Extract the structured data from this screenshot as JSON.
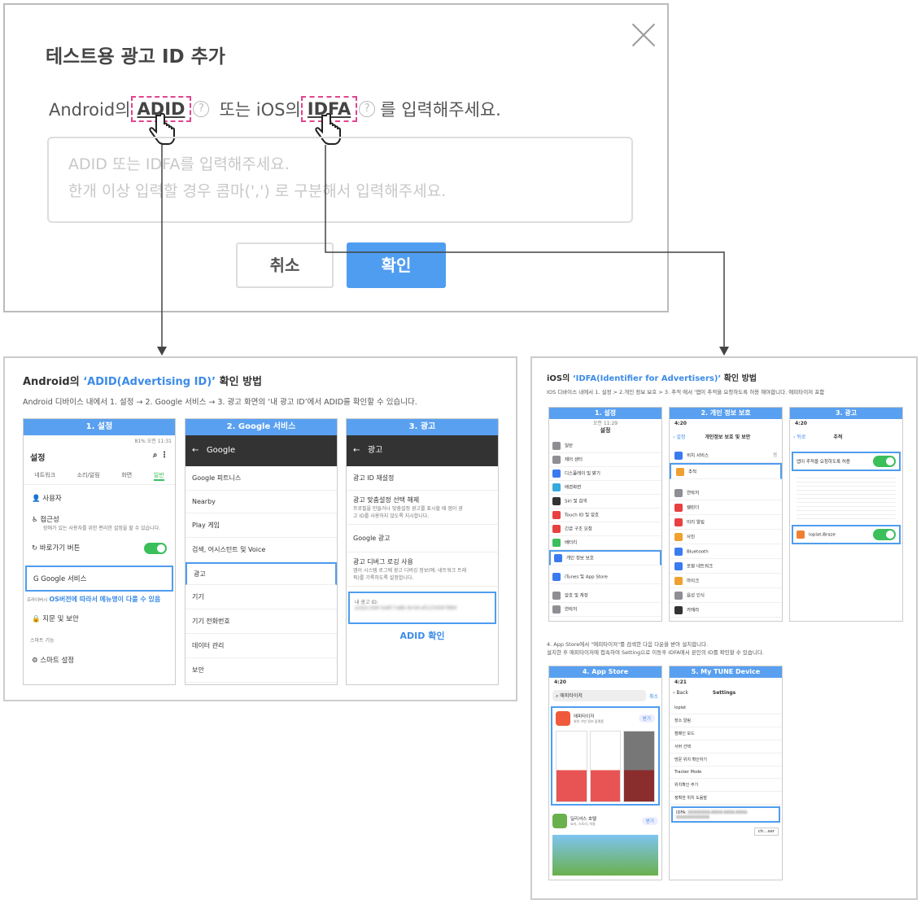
{
  "dialog": {
    "title": "테스트용 광고 ID 추가",
    "prefix": "Android의",
    "adid": "ADID",
    "middle": "또는 iOS의",
    "idfa": "IDFA",
    "suffix": "를 입력해주세요.",
    "qmark": "?",
    "placeholder_line1": "ADID 또는 IDFA를 입력해주세요.",
    "placeholder_line2": "한개 이상 입력할 경우 콤마(',') 로 구분해서 입력해주세요.",
    "cancel": "취소",
    "confirm": "확인"
  },
  "android": {
    "title_prefix": "Android의",
    "title_highlight": "‘ADID(Advertising ID)’",
    "title_suffix": "확인 방법",
    "desc": "Android 디바이스 내에서 1. 설정 → 2. Google 서비스 → 3. 광고 화면의 ‘내 광고 ID’에서 ADID를 확인할 수 있습니다.",
    "s1": {
      "header": "1. 설정",
      "status": "81% 오전 11:31",
      "title": "설정",
      "tabs": [
        "네트워크",
        "소리/알림",
        "화면",
        "일반"
      ],
      "items": [
        {
          "label": "사용자"
        },
        {
          "label": "접근성",
          "sub": "장애가 있는 사용자를 위한 편리한 설정을 할 수 있습니다."
        },
        {
          "label": "바로가기 버튼"
        },
        {
          "label": "Google 서비스"
        }
      ],
      "note": "OS버전에 따라서 메뉴명이 다를 수 있음",
      "section1": "프라이버시",
      "item5": "지문 및 보안",
      "section2": "스마트 기능",
      "item6": "스마트 설정"
    },
    "s2": {
      "header": "2. Google 서비스",
      "bar": "Google",
      "items": [
        "Google 피트니스",
        "Nearby",
        "Play 게임",
        "검색, 어시스턴트 및 Voice",
        "광고",
        "기기",
        "기기 전화번호",
        "데이터 관리",
        "보안"
      ]
    },
    "s3": {
      "header": "3. 광고",
      "bar": "광고",
      "items": [
        {
          "label": "광고 ID 재설정"
        },
        {
          "label": "광고 맞춤설정 선택 해제",
          "sub": "프로필을 만들거나 맞춤설정 광고를 표시할 때 앱이 광고 ID를 사용하지 않도록 지시합니다."
        },
        {
          "label": "Google 광고"
        },
        {
          "label": "광고 디버그 로깅 사용",
          "sub": "앱이 시스템 로그에 광고 디버깅 정보(예: 네트워크 트래픽)를 기록하도록 설정합니다."
        }
      ],
      "adid_label": "내 광고 ID:",
      "adid_value": "a1b2c3d4-5e6f-7a8b-9c0d-ef1234567890",
      "adid_check": "ADID 확인"
    }
  },
  "ios": {
    "title_prefix": "iOS의",
    "title_highlight": "‘IDFA(Identifier for Advertisers)’",
    "title_suffix": "확인 방법",
    "desc": "IOS 디바이스 내에서 1. 설정 > 2.개인 정보 보호 > 3. 추적 에서 ‘앱이 추적을 요청하도록 허용 해야합니다. 애피타이저 포함",
    "s1": {
      "header": "1. 설정",
      "status": "오전 11:29",
      "title": "설정",
      "items": [
        "일반",
        "제어 센터",
        "디스플레이 및 밝기",
        "배경화면",
        "Siri 및 검색",
        "Touch ID 및 암호",
        "긴급 구조 요청",
        "배터리",
        "개인 정보 보호",
        "iTunes 및 App Store",
        "암호 및 계정",
        "연락처"
      ]
    },
    "s2": {
      "header": "2. 개인 정보 보호",
      "time": "4:20",
      "back": "설정",
      "title": "개인정보 보호 및 보안",
      "items": [
        "위치 서비스",
        "추적",
        "연락처",
        "캘린더",
        "미리 알림",
        "사진",
        "Bluetooth",
        "로컬 네트워크",
        "마이크",
        "음성 인식",
        "카메라"
      ],
      "badge": "켬"
    },
    "s3": {
      "header": "3. 광고",
      "time": "4:20",
      "back": "뒤로",
      "title": "추적",
      "allow": "앱이 추적을 요청하도록 허용",
      "app": "loplat-Braze"
    },
    "step4": "4. App Store에서 \"애피타이저\"를 검색한 다음 다운을 받아 설치합니다.",
    "step4b": "설치한 후 애피타이저에 접속하여 Setting으로 이동후 IDFA에서 본인의 ID를 확인할 수 있습니다.",
    "s4": {
      "header": "4. App Store",
      "time": "4:20",
      "search": "애피타이저",
      "cancel": "취소",
      "app1": "애피타이저",
      "app1_sub": "위치 기반 정보 플랫폼",
      "get": "받기",
      "app2": "딜리셔스 호텔",
      "app2_sub": "요리, 스토리, 미용"
    },
    "s5": {
      "header": "5. My TUNE Device",
      "time": "4:21",
      "back": "Back",
      "title": "Settings",
      "items": [
        "loplat",
        "장소 알림",
        "캠페인 모드",
        "서버 선택",
        "방문 위치 확인하기",
        "Tracker Mode",
        "위치확인 주기",
        "정확한 위치 도움말"
      ],
      "idfa_label": "IDFA:",
      "idfa_value": "XXXXXXXX-XXXX-XXXX-XXXX-XXXXXXXXXXXX",
      "btn": "ch...ser"
    }
  }
}
